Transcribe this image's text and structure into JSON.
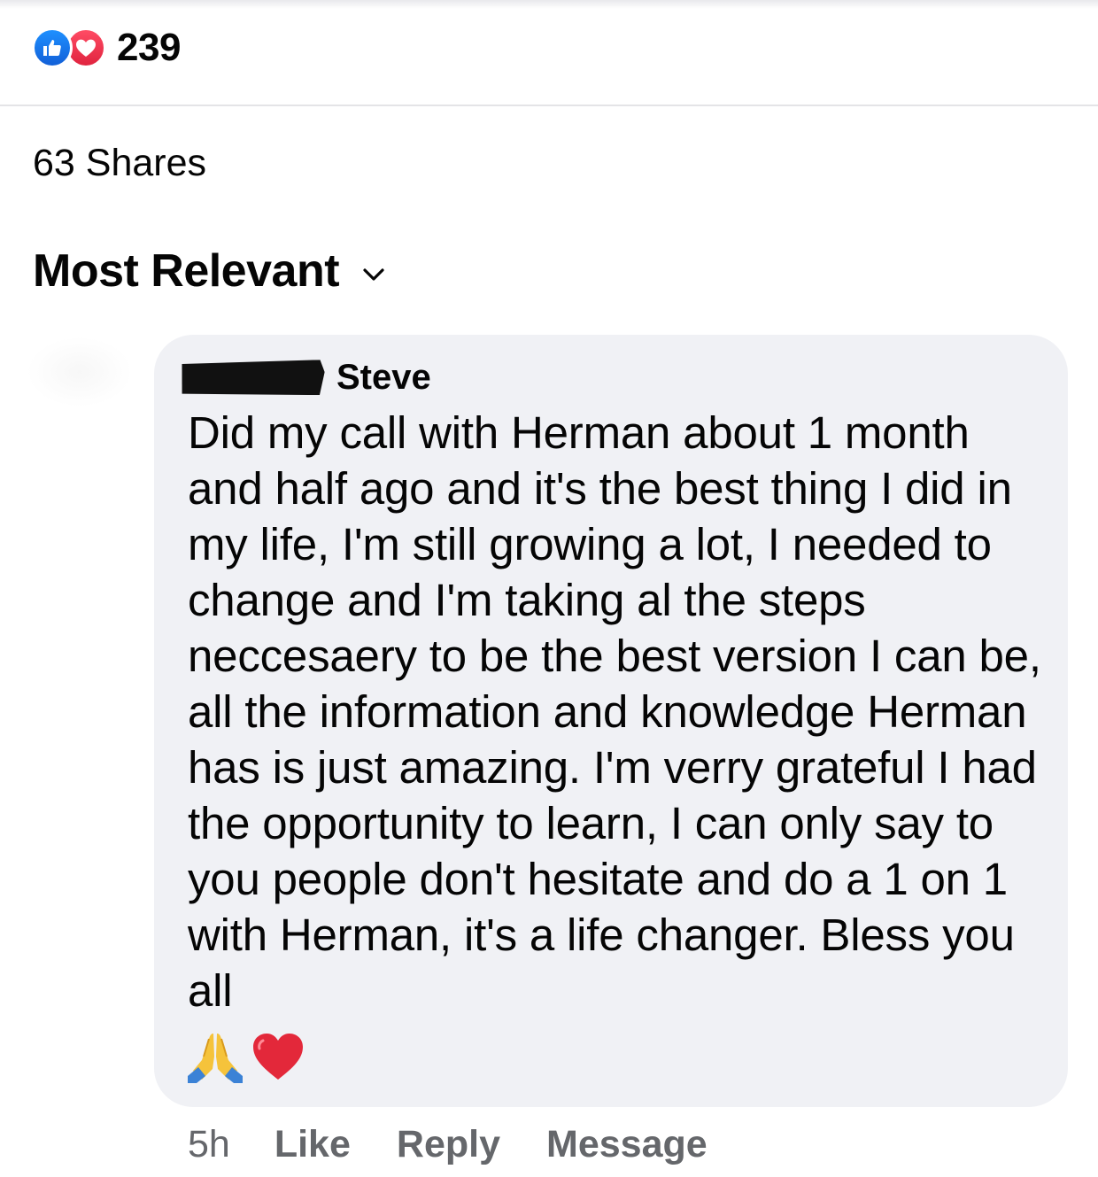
{
  "reactions": {
    "icons": [
      "like-icon",
      "love-icon"
    ],
    "count": "239",
    "colors": {
      "like": "#1877f2",
      "love": "#f33e58"
    }
  },
  "shares": {
    "label": "63 Shares"
  },
  "sort": {
    "label": "Most Relevant",
    "icon": "chevron-down-icon"
  },
  "comment": {
    "author": "Steve",
    "author_redacted": true,
    "text": "Did my call with Herman about 1 month and half ago and it's the best thing I did in my life, I'm still growing a lot, I needed to change and I'm taking al the steps neccesaery to be the best version I can be, all the information and knowledge Herman has is just amazing. I'm verry grateful I had the opportunity to learn, I can only say to you people don't hesitate and do a 1 on 1 with Herman, it's a life changer. Bless you all",
    "emojis": [
      "folded-hands-icon",
      "red-heart-icon"
    ],
    "bubble_color": "#f0f1f5",
    "time": "5h",
    "actions": {
      "like": "Like",
      "reply": "Reply",
      "message": "Message"
    }
  }
}
